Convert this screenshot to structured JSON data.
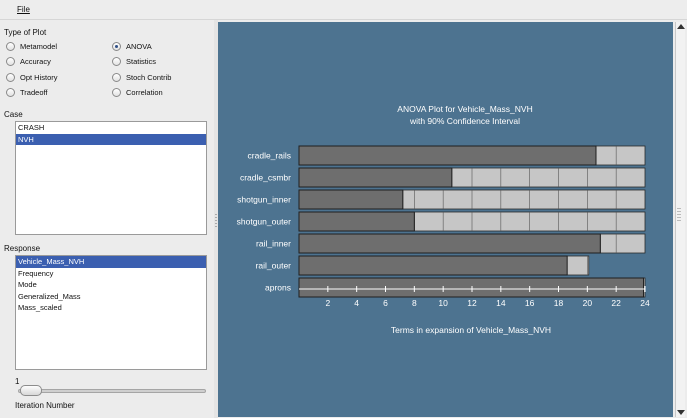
{
  "menu": {
    "file": "File"
  },
  "plot_type": {
    "label": "Type of Plot",
    "options": [
      {
        "label": "Metamodel",
        "selected": false
      },
      {
        "label": "ANOVA",
        "selected": true
      },
      {
        "label": "Accuracy",
        "selected": false
      },
      {
        "label": "Statistics",
        "selected": false
      },
      {
        "label": "Opt History",
        "selected": false
      },
      {
        "label": "Stoch Contrib",
        "selected": false
      },
      {
        "label": "Tradeoff",
        "selected": false
      },
      {
        "label": "Correlation",
        "selected": false
      }
    ]
  },
  "case": {
    "label": "Case",
    "items": [
      "CRASH",
      "NVH"
    ],
    "selected": "NVH"
  },
  "response": {
    "label": "Response",
    "items": [
      "Vehicle_Mass_NVH",
      "Frequency",
      "Mode",
      "Generalized_Mass",
      "Mass_scaled"
    ],
    "selected": "Vehicle_Mass_NVH"
  },
  "iteration": {
    "value": "1",
    "label": "Iteration Number"
  },
  "colors": {
    "plot_bg": "#4d7390",
    "bar": "#6e6e6e",
    "band": "#c6c6c6",
    "selection": "#3b5fb0"
  },
  "chart_data": {
    "type": "bar",
    "orientation": "horizontal",
    "title": "ANOVA Plot for Vehicle_Mass_NVH",
    "subtitle": "with 90% Confidence Interval",
    "xlabel": "Terms in expansion of Vehicle_Mass_NVH",
    "xlim": [
      0,
      24
    ],
    "xticks": [
      2,
      4,
      6,
      8,
      10,
      12,
      14,
      16,
      18,
      20,
      22,
      24
    ],
    "categories": [
      "cradle_rails",
      "cradle_csmbr",
      "shotgun_inner",
      "shotgun_outer",
      "rail_inner",
      "rail_outer",
      "aprons"
    ],
    "values": [
      20.6,
      10.6,
      7.2,
      8.0,
      20.9,
      18.6,
      23.9
    ],
    "ci_upper": [
      24.0,
      24.0,
      24.0,
      24.0,
      24.0,
      20.1,
      24.0
    ]
  }
}
